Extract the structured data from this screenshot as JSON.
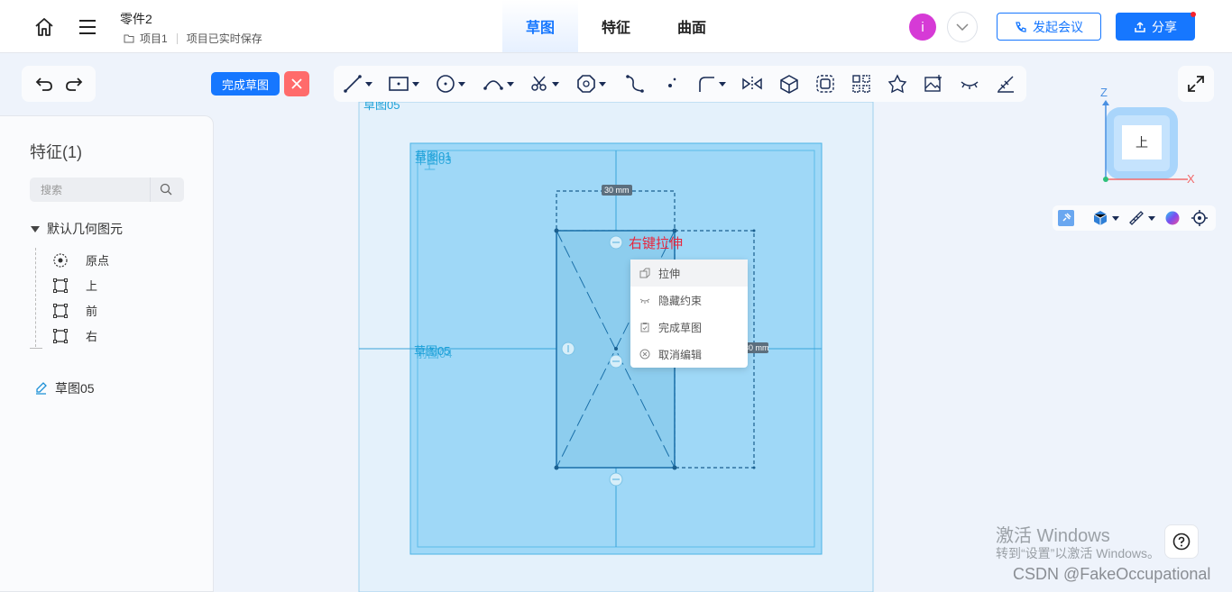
{
  "header": {
    "doc_title": "零件2",
    "project": "项目1",
    "save_status": "项目已实时保存",
    "tabs": [
      {
        "label": "草图",
        "active": true
      },
      {
        "label": "特征",
        "active": false
      },
      {
        "label": "曲面",
        "active": false
      }
    ],
    "avatar_letter": "i",
    "meeting_label": "发起会议",
    "share_label": "分享"
  },
  "toolbar": {
    "finish_sketch": "完成草图",
    "tools": [
      "line-icon",
      "rectangle-icon",
      "circle-icon",
      "arc-icon",
      "trim-icon",
      "polygon-icon",
      "spline-icon",
      "point-icon",
      "fillet-icon",
      "mirror-icon",
      "solid-icon",
      "offset-icon",
      "pattern-icon",
      "project-icon",
      "image-icon",
      "hide-constraints-icon",
      "dimension-icon"
    ]
  },
  "sidebar": {
    "title": "特征(1)",
    "search_placeholder": "搜索",
    "group_label": "默认几何图元",
    "items": [
      {
        "label": "原点",
        "icon": "origin-icon"
      },
      {
        "label": "上",
        "icon": "plane-icon"
      },
      {
        "label": "前",
        "icon": "plane-icon"
      },
      {
        "label": "右",
        "icon": "plane-icon"
      }
    ],
    "sketch_label": "草图05"
  },
  "canvas": {
    "sketch_top_label": "草图05",
    "plane_label_top": "草图01",
    "plane_label_top_overlap": "上",
    "plane_label_top_overlap2": "草图03",
    "plane_label_mid": "草图05",
    "plane_label_mid_overlap": "前图04",
    "dim_top": "30 mm",
    "dim_right": "30 mm",
    "hint": "右键拉伸"
  },
  "context_menu": {
    "items": [
      {
        "label": "拉伸",
        "icon": "extrude-icon",
        "highlight": true
      },
      {
        "label": "隐藏约束",
        "icon": "hide-icon",
        "highlight": false
      },
      {
        "label": "完成草图",
        "icon": "clipboard-icon",
        "highlight": false
      },
      {
        "label": "取消编辑",
        "icon": "cancel-icon",
        "highlight": false
      }
    ]
  },
  "view_cube": {
    "face_label": "上",
    "axis_z": "Z",
    "axis_x": "X"
  },
  "watermark": {
    "line1": "激活 Windows",
    "line2": "转到“设置”以激活 Windows。",
    "csdn": "CSDN @FakeOccupational"
  },
  "colors": {
    "accent": "#1677ff",
    "plane_fill": "#9fd8f7",
    "sketch_line": "#1a6fa8",
    "hint_red": "#e8263e"
  }
}
